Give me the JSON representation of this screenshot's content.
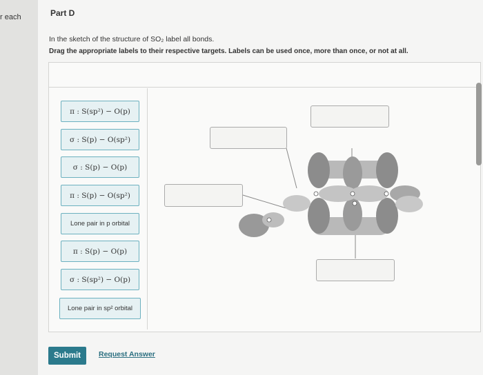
{
  "sidebar": {
    "text": "r each"
  },
  "part": {
    "title": "Part D"
  },
  "instructions": {
    "line1": "In the sketch of the structure of SO₂ label all bonds.",
    "line2": "Drag the appropriate labels to their respective targets. Labels can be used once, more than once, or not at all."
  },
  "labels": [
    "π : S(sp²) − O(p)",
    "σ : S(p) − O(sp²)",
    "σ : S(p) − O(p)",
    "π : S(p) − O(sp²)",
    "Lone pair in p orbital",
    "π : S(p) − O(p)",
    "σ : S(sp²) − O(p)",
    "Lone pair in sp² orbital"
  ],
  "footer": {
    "submit": "Submit",
    "request": "Request Answer"
  },
  "colors": {
    "accent": "#2b7a8c",
    "tile_bg": "#e6f1f3",
    "tile_border": "#6bb0bf"
  }
}
